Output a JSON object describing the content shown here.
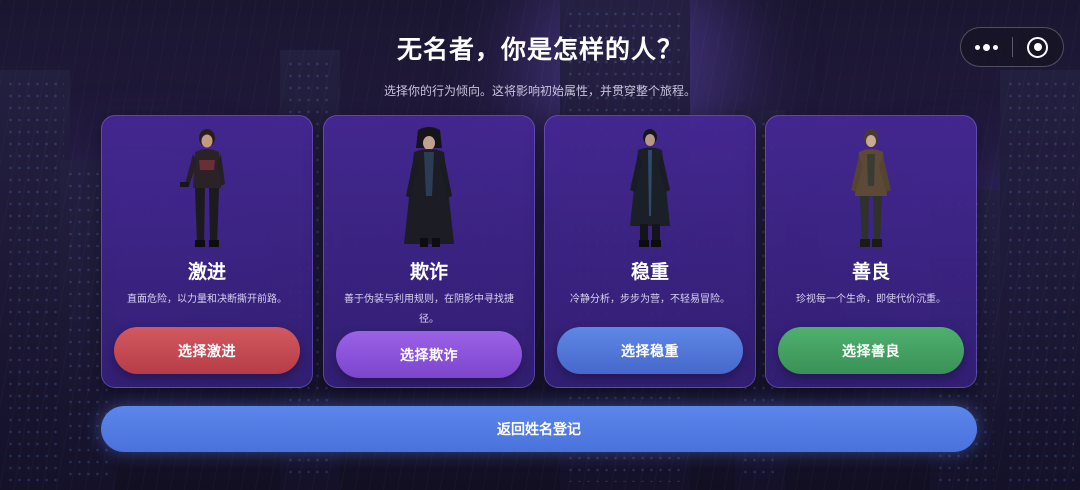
{
  "header": {
    "title": "无名者，你是怎样的人？",
    "subtitle": "选择你的行为倾向。这将影响初始属性，并贯穿整个旅程。"
  },
  "capsule": {
    "more_icon": "more-dots-icon",
    "close_icon": "target-close-icon"
  },
  "choices": [
    {
      "name": "激进",
      "description": "直面危险，以力量和决断撕开前路。",
      "button": "选择激进",
      "color": "#c9474f",
      "portrait": "female-fighter-with-pistol"
    },
    {
      "name": "欺诈",
      "description": "善于伪装与利用规则，在阴影中寻找捷径。",
      "button": "选择欺诈",
      "color": "#8e52dc",
      "portrait": "hooded-figure-in-long-coat"
    },
    {
      "name": "稳重",
      "description": "冷静分析，步步为营，不轻易冒险。",
      "button": "选择稳重",
      "color": "#5277d8",
      "portrait": "figure-in-dark-trench-coat"
    },
    {
      "name": "善良",
      "description": "珍视每一个生命，即使代价沉重。",
      "button": "选择善良",
      "color": "#43a463",
      "portrait": "figure-in-brown-jacket"
    }
  ],
  "footer": {
    "back_button": "返回姓名登记"
  }
}
